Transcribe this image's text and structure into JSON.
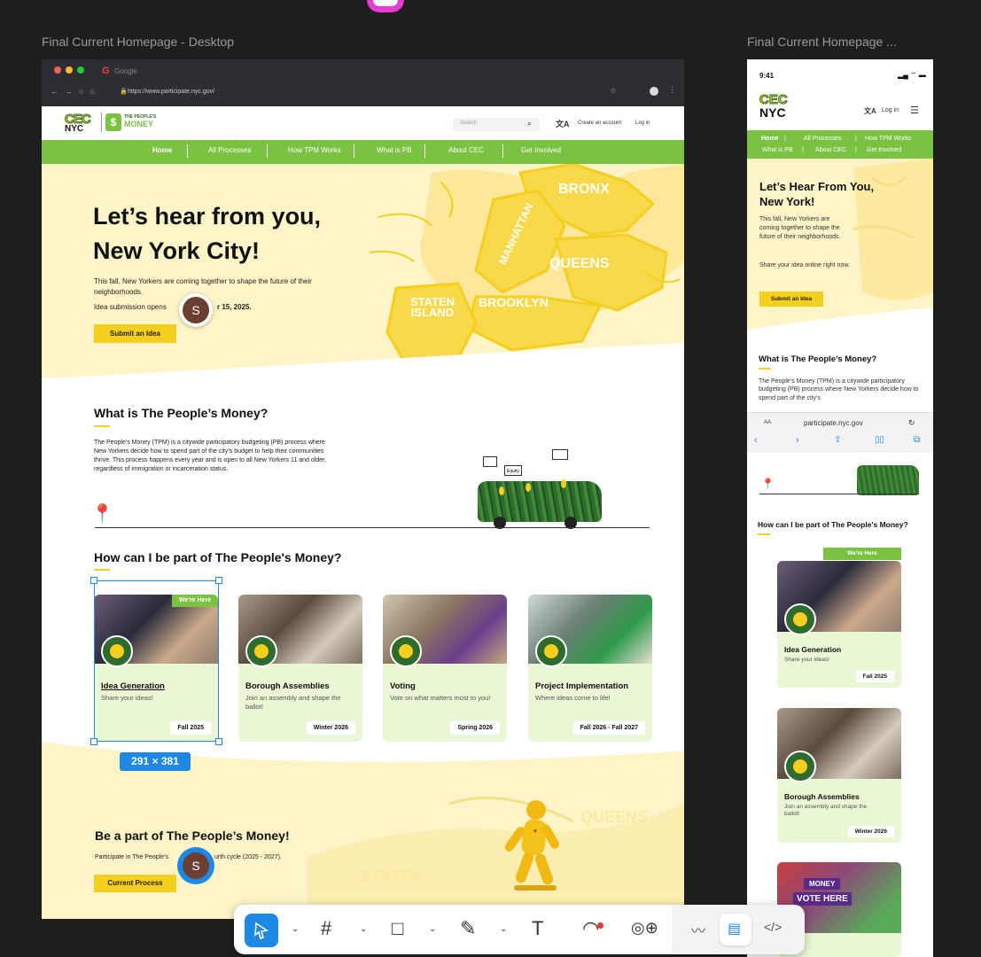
{
  "canvas": {
    "desktop_frame_title": "Final Current Homepage - Desktop",
    "mobile_frame_title": "Final Current Homepage ...",
    "selection_size": "291 × 381",
    "cursor_initial": "S"
  },
  "browser": {
    "tab_title": "Google",
    "url": "https://www.participate.nyc.gov/"
  },
  "site": {
    "logo_cec": "CEC",
    "logo_nyc": "NYC",
    "logo_pm_small": "THE PEOPLE'S",
    "logo_pm": "MONEY",
    "search_placeholder": "Search",
    "create_account": "Create an account",
    "login": "Log in",
    "nav": [
      "Home",
      "All Processes",
      "How TPM Works",
      "What is PB",
      "About CEC",
      "Get Involved"
    ]
  },
  "hero": {
    "title_line1": "Let’s hear from you,",
    "title_line2": "New York City!",
    "body": "This fall, New Yorkers are coming together to shape the future of their neighborhoods.",
    "date_start": "Idea submission opens",
    "date_end": "r 15, 2025.",
    "button": "Submit an Idea",
    "map_labels": [
      "BRONX",
      "MANHATTAN",
      "QUEENS",
      "STATEN ISLAND",
      "BROOKLYN"
    ]
  },
  "what": {
    "title": "What is The People’s Money?",
    "body": "The People’s Money (TPM) is a citywide participatory budgeting (PB) process where New Yorkers decide how to spend part of the city’s budget to help their communities thrive. This process happens every year and is open to all New Yorkers 11 and older, regardless of immigration or incarceration status.",
    "bus_sign": "Equity"
  },
  "how": {
    "title": "How can I be part of The People's Money?",
    "badge": "We're Here",
    "cards": [
      {
        "title": "Idea Generation",
        "desc": "Share your ideas!",
        "date": "Fall 2025"
      },
      {
        "title": "Borough Assemblies",
        "desc": "Join an assembly and shape the ballot!",
        "date": "Winter 2026"
      },
      {
        "title": "Voting",
        "desc": "Vote on what matters most to you!",
        "date": "Spring 2026"
      },
      {
        "title": "Project Implementation",
        "desc": "Where ideas come to life!",
        "date": "Fall 2026 - Fall 2027"
      }
    ]
  },
  "be_part": {
    "title": "Be a part of The People’s Money!",
    "body_start": "Participate in The People’s",
    "body_end": "urth cycle (2025 - 2027).",
    "button": "Current Process"
  },
  "mobile": {
    "time": "9:41",
    "login": "Log in",
    "nav_row1": [
      "Home",
      "All Processes",
      "How TPM Works"
    ],
    "nav_row2": [
      "What is PB",
      "About CEC",
      "Get Involved"
    ],
    "hero_title": "Let’s Hear From You, New York!",
    "hero_body": "This fall, New Yorkers are coming together to shape the future of their neighborhoods.",
    "hero_body2": "Share your idea online right now.",
    "hero_button": "Submit an Idea",
    "what_title": "What is The People’s Money?",
    "what_body": "The People’s Money (TPM) is a citywide participatory budgeting (PB) process where New Yorkers decide how to spend part of the city’s",
    "url_aa": "AA",
    "url": "participate.nyc.gov",
    "how_title": "How can I be part of The People's Money?",
    "badge": "We're Here",
    "cards": [
      {
        "title": "Idea Generation",
        "desc": "Share your ideas!",
        "date": "Fall 2025"
      },
      {
        "title": "Borough Assemblies",
        "desc": "Join an assembly and shape the ballot!",
        "date": "Winter 2026"
      }
    ],
    "card3_sign1": "MONEY",
    "card3_sign2": "VOTE HERE"
  },
  "colors": {
    "green": "#7bc142",
    "yellow": "#f5cf1d",
    "cream": "#fdf5c8",
    "card": "#e9f7d4",
    "selection": "#1e88e5"
  }
}
